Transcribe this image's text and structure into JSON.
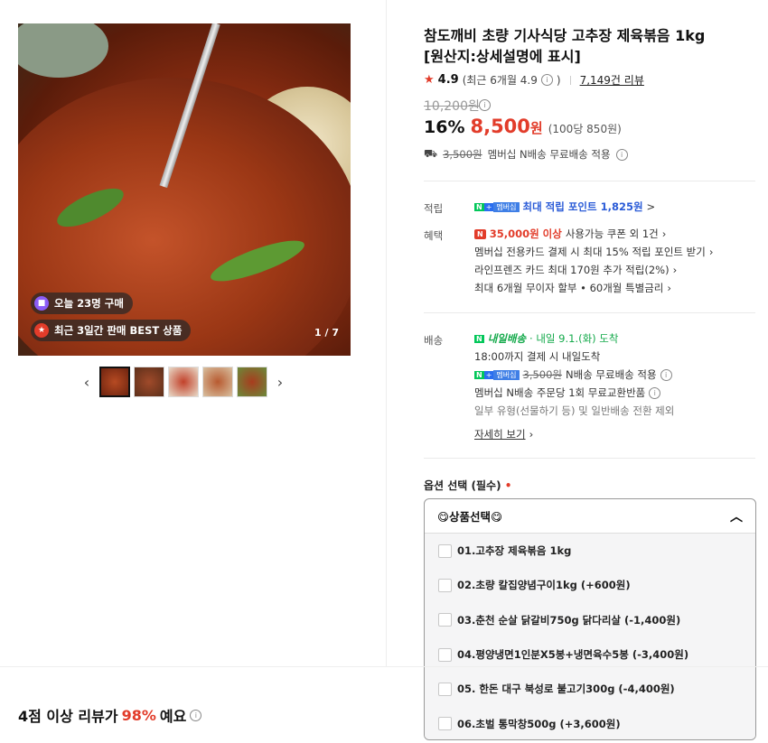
{
  "product": {
    "title_line1": "참도깨비 초량 기사식당 고추장 제육볶음 1kg",
    "title_line2": "[원산지:상세설명에 표시]",
    "rating": "4.9",
    "rating_recent": "(최근 6개월 4.9",
    "rating_recent_close": ")",
    "reviews": "7,149건 리뷰",
    "original_price": "10,200원",
    "discount": "16%",
    "price_num": "8,500",
    "price_unit": "원",
    "unit_price": "(100당 850원)",
    "shipping_strike": "3,500원",
    "shipping_text": "멤버십 N배송 무료배송 적용"
  },
  "gallery": {
    "badge_today": "오늘 23명 구매",
    "badge_best": "최근 3일간 판매 BEST 상품",
    "counter": "1 / 7",
    "prev_arrow": "‹",
    "next_arrow": "›"
  },
  "points": {
    "label": "적립",
    "badge": "멤버십",
    "text": "최대 적립 포인트 1,825원",
    "arrow": ">"
  },
  "benefits": {
    "label": "혜택",
    "coupon_prefix": "35,000원 이상",
    "coupon_text": "사용가능 쿠폰 외 1건",
    "line2": "멤버십 전용카드 결제 시 최대 15% 적립 포인트 받기",
    "line3": "라인프렌즈 카드 최대 170원 추가 적립(2%)",
    "line4": "최대 6개월 무이자 할부 • 60개월 특별금리"
  },
  "delivery": {
    "label": "배송",
    "brand": "내일배송",
    "arrival": "· 내일 9.1.(화) 도착",
    "cutoff": "18:00까지 결제 시 내일도착",
    "badge": "멤버십",
    "fee_strike": "3,500원",
    "fee_text": "N배송 무료배송 적용",
    "exchange": "멤버십 N배송 주문당 1회 무료교환반품",
    "exclusion": "일부 유형(선물하기 등) 및 일반배송 전환 제외",
    "more": "자세히 보기"
  },
  "options": {
    "title": "옵션 선택 (필수)",
    "required_mark": "•",
    "selected": "😋상품선택😋",
    "items": [
      "01.고추장 제육볶음 1kg",
      "02.초량 칼집양념구이1kg (+600원)",
      "03.춘천 순살 닭갈비750g 닭다리살 (-1,400원)",
      "04.평양냉면1인분X5봉+냉면육수5봉 (-3,400원)",
      "05. 한돈 대구 북성로 불고기300g (-4,400원)",
      "06.초벌 통막창500g (+3,600원)"
    ]
  },
  "review_summary": {
    "prefix": "4점 이상 리뷰가",
    "percent": "98%",
    "suffix": "예요"
  },
  "colors": {
    "accent_red": "#e23c2a",
    "points_blue": "#2a5bd7",
    "delivery_green": "#13a94a"
  }
}
